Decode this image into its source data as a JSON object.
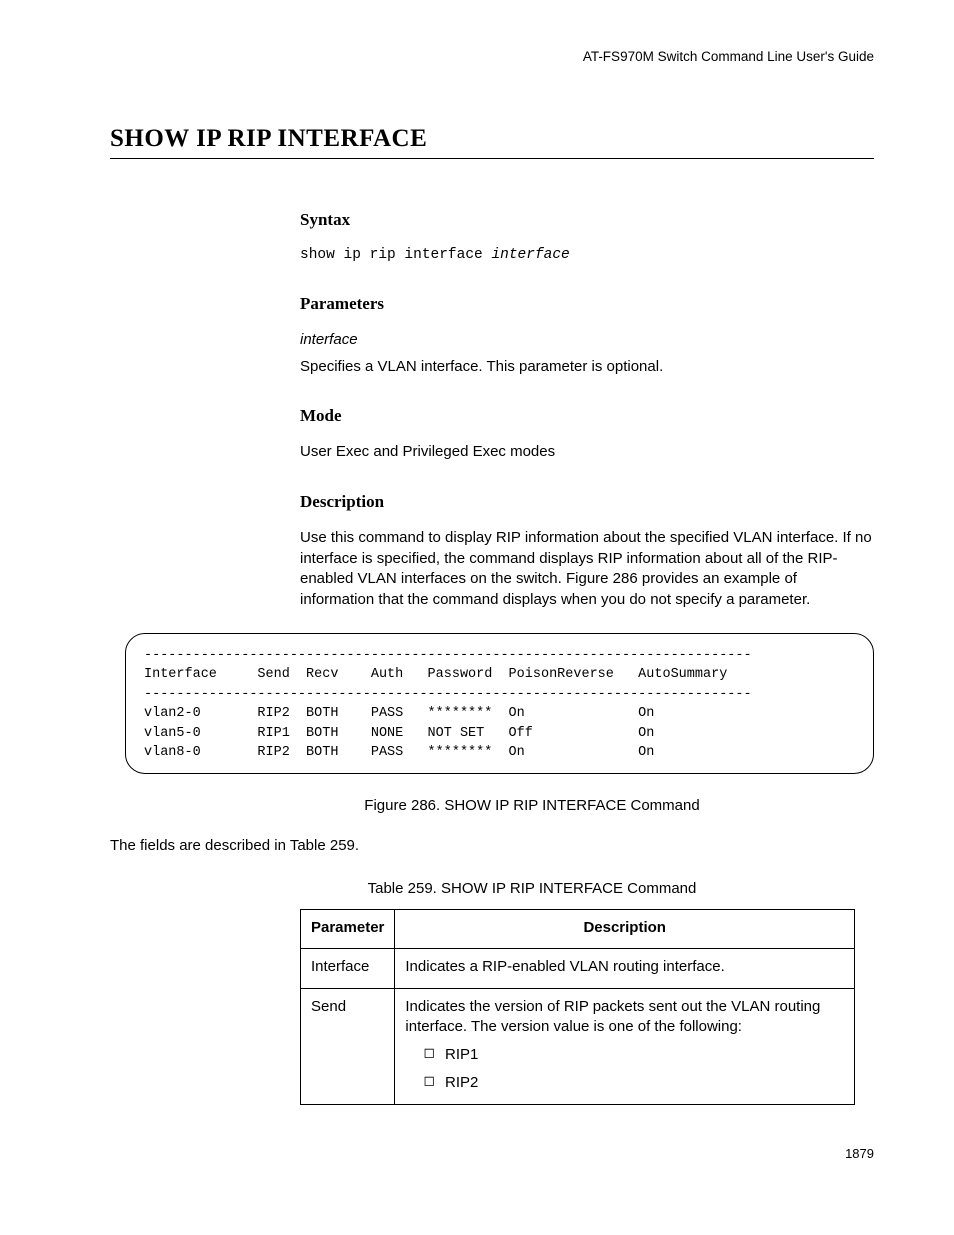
{
  "header": "AT-FS970M Switch Command Line User's Guide",
  "title": "SHOW IP RIP INTERFACE",
  "sections": {
    "syntax": {
      "head": "Syntax",
      "line_prefix": "show ip rip interface ",
      "line_arg": "interface"
    },
    "parameters": {
      "head": "Parameters",
      "name": "interface",
      "desc": "Specifies a VLAN interface. This parameter is optional."
    },
    "mode": {
      "head": "Mode",
      "text": "User Exec and Privileged Exec modes"
    },
    "description": {
      "head": "Description",
      "text": "Use this command to display RIP information about the specified VLAN interface. If no interface is specified, the command displays RIP information about all of the RIP-enabled VLAN interfaces on the switch. Figure 286 provides an example of information that the command displays when you do not specify a parameter."
    }
  },
  "code": "---------------------------------------------------------------------------\nInterface     Send  Recv    Auth   Password  PoisonReverse   AutoSummary\n---------------------------------------------------------------------------\nvlan2-0       RIP2  BOTH    PASS   ********  On              On\nvlan5-0       RIP1  BOTH    NONE   NOT SET   Off             On\nvlan8-0       RIP2  BOTH    PASS   ********  On              On",
  "figure_caption": "Figure 286. SHOW IP RIP INTERFACE Command",
  "after_figure": "The fields are described in Table 259.",
  "table_caption": "Table 259. SHOW IP RIP INTERFACE Command",
  "table": {
    "headers": {
      "p": "Parameter",
      "d": "Description"
    },
    "rows": [
      {
        "p": "Interface",
        "d": "Indicates a RIP-enabled VLAN routing interface."
      },
      {
        "p": "Send",
        "d": "Indicates the version of RIP packets sent out the VLAN routing interface. The version value is one of the following:",
        "list": [
          "RIP1",
          "RIP2"
        ]
      }
    ]
  },
  "page_number": "1879"
}
